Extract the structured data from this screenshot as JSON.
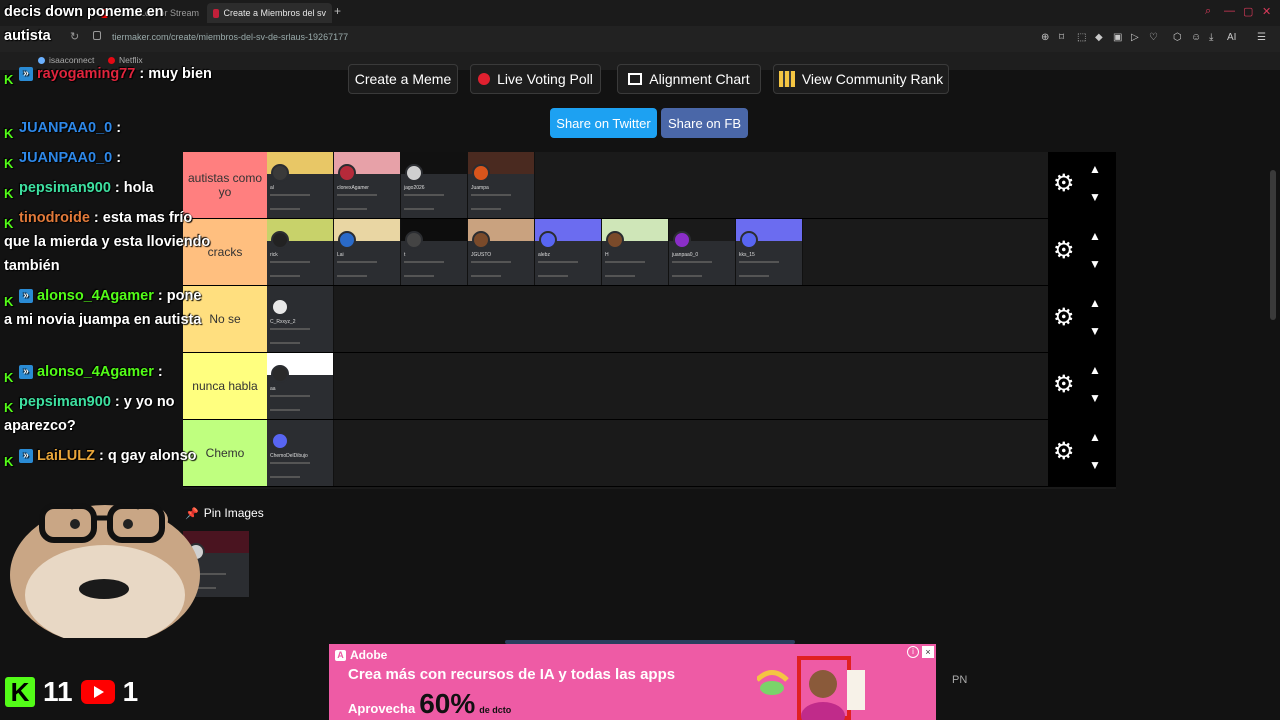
{
  "browser": {
    "tabs": [
      {
        "label": "Anime Lofi for Stream"
      },
      {
        "label": "Create a Miembros del sv"
      }
    ],
    "new_tab": "+",
    "url_host": "tiermaker.com",
    "url_path": "/create/miembros-del-sv-de-srlaus-19267177",
    "bookmarks": [
      {
        "label": "isaaconnect",
        "color": "#6bb1ff"
      },
      {
        "label": "Netflix",
        "color": "#e50914"
      }
    ],
    "extension_label": "AI"
  },
  "toolbar": {
    "create_meme": "Create a Meme",
    "live_voting": "Live Voting Poll",
    "alignment_chart": "Alignment Chart",
    "community_rank": "View Community Rank",
    "share_twitter": "Share on Twitter",
    "share_fb": "Share on FB"
  },
  "colors": {
    "twitter": "#1da1f2",
    "facebook": "#3b5998",
    "kick_green": "#53fc18"
  },
  "tiers": [
    {
      "label": "autistas como yo",
      "color": "#ff7f7f"
    },
    {
      "label": "cracks",
      "color": "#ffbf7f"
    },
    {
      "label": "No se",
      "color": "#ffdf7f"
    },
    {
      "label": "nunca habla",
      "color": "#ffff7f"
    },
    {
      "label": "Chemo",
      "color": "#bfff7f"
    }
  ],
  "tier_tiles": [
    [
      {
        "name": "al",
        "banner": "#e8c766",
        "avatar": "#3a3a3a"
      },
      {
        "name": "clonexAgamer",
        "banner": "#e7a1a8",
        "avatar": "#b52a3a"
      },
      {
        "name": "jago2026",
        "banner": "#111111",
        "avatar": "#cfcfcf"
      },
      {
        "name": "Juampa",
        "banner": "#4a2a20",
        "avatar": "#d8551c"
      }
    ],
    [
      {
        "name": "rick",
        "banner": "#c8d26a",
        "avatar": "#222222"
      },
      {
        "name": "Lai",
        "banner": "#e9d6a3",
        "avatar": "#2a6ac8"
      },
      {
        "name": "t",
        "banner": "#0d0d0d",
        "avatar": "#444444"
      },
      {
        "name": "JGUSTO",
        "banner": "#c9a27f",
        "avatar": "#7a4a2a"
      },
      {
        "name": "alebz",
        "banner": "#6b6cf0",
        "avatar": "#5865f2"
      },
      {
        "name": "H",
        "banner": "#cfe6b8",
        "avatar": "#7a4a2a"
      },
      {
        "name": "juanpaa0_0",
        "banner": "#1a1a1a",
        "avatar": "#8a2ec8"
      },
      {
        "name": "kks_15",
        "banner": "#6b6cf0",
        "avatar": "#5865f2"
      }
    ],
    [
      {
        "name": "C_Rxxyz_2",
        "banner": "#2b2d31",
        "avatar": "#e8e8e8"
      }
    ],
    [
      {
        "name": "aa",
        "banner": "#ffffff",
        "avatar": "#2a2a2a"
      }
    ],
    [
      {
        "name": "ChemoDelDibujo",
        "banner": "#2b2d31",
        "avatar": "#5865f2"
      }
    ]
  ],
  "pin": {
    "label": "Pin Images",
    "tile": {
      "name": "ell",
      "banner": "#4a1420",
      "avatar": "#d0d0d0"
    }
  },
  "chat": [
    {
      "user": "",
      "text": "decis down poneme en autista",
      "user_color": "#ffffff"
    },
    {
      "user": "rayogaming77",
      "text": ": muy bien",
      "user_color": "#e0253d"
    },
    {
      "user": "JUANPAA0_0",
      "text": ":",
      "user_color": "#2e88e8"
    },
    {
      "user": "JUANPAA0_0",
      "text": ":",
      "user_color": "#2e88e8"
    },
    {
      "user": "pepsiman900",
      "text": ": hola",
      "user_color": "#3ee0a0"
    },
    {
      "user": "tinodroide",
      "text": ": esta mas frío que la mierda y esta lloviendo también",
      "user_color": "#e27a3a"
    },
    {
      "user": "alonso_4Agamer",
      "text": ": pone a mi novia juampa en autista",
      "user_color": "#53fc18"
    },
    {
      "user": "alonso_4Agamer",
      "text": ":",
      "user_color": "#53fc18"
    },
    {
      "user": "pepsiman900",
      "text": ": y yo no aparezco?",
      "user_color": "#3ee0a0"
    },
    {
      "user": "LaiLULZ",
      "text": ": q gay alonso",
      "user_color": "#e8a63a"
    }
  ],
  "stats": {
    "kick_count": "11",
    "youtube_count": "1"
  },
  "ad": {
    "brand": "Adobe",
    "headline": "Crea más con recursos de IA y todas las apps",
    "line2": "Aprovecha",
    "percent": "60%",
    "suffix": "de dcto",
    "close": "×",
    "info": "i",
    "tag": "PN"
  }
}
